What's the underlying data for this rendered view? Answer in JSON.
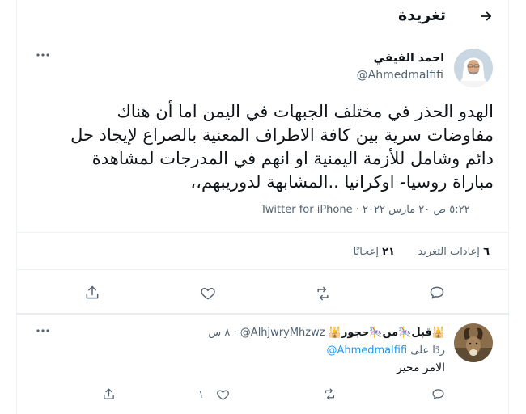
{
  "header": {
    "title": "تغريدة"
  },
  "tweet": {
    "author_name": "احمد الفيفي",
    "author_handle": "@Ahmedmalfifi",
    "text": "الهدو الحذر في مختلف الجبهات في اليمن اما أن هناك مفاوضات سرية بين كافة الاطراف المعنية بالصراع لإيجاد حل دائم وشامل للأزمة اليمنية او انهم في المدرجات لمشاهدة مباراة روسيا- اوكرانيا ..المشابهة لدوريبهم،،",
    "time": "٥:٢٢ ص",
    "date": "٢٠ مارس ٢٠٢٢",
    "separator": "·",
    "source": "Twitter for iPhone",
    "retweets_count": "٦",
    "retweets_label": "إعادات التغريد",
    "likes_count": "٢١",
    "likes_label": "إعجابًا"
  },
  "reply": {
    "author_name": "🕌قبل🎠من🎠حجور🕌",
    "author_handle": "@AlhjwryMhzwz",
    "separator": "·",
    "time": "٨ س",
    "replying_prefix": "ردًا على",
    "replying_to": "@Ahmedmalfifi",
    "text": "الامر محير",
    "likes_count": "١"
  },
  "colors": {
    "accent": "#1d9bf0",
    "text": "#0f1419",
    "muted": "#536471",
    "border": "#eff3f4"
  },
  "icons": [
    "back-arrow-icon",
    "more-icon",
    "reply-icon",
    "retweet-icon",
    "like-icon",
    "share-icon"
  ]
}
